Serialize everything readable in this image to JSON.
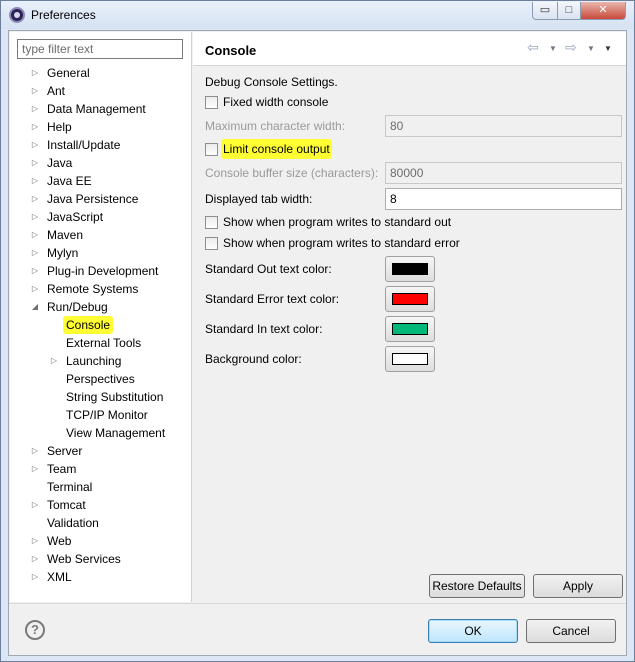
{
  "window": {
    "title": "Preferences",
    "minimize_glyph": "▭",
    "maximize_glyph": "□",
    "close_glyph": "✕"
  },
  "filter": {
    "placeholder": "type filter text"
  },
  "tree": [
    {
      "label": "General",
      "twisty": "▷",
      "level": 0
    },
    {
      "label": "Ant",
      "twisty": "▷",
      "level": 0
    },
    {
      "label": "Data Management",
      "twisty": "▷",
      "level": 0
    },
    {
      "label": "Help",
      "twisty": "▷",
      "level": 0
    },
    {
      "label": "Install/Update",
      "twisty": "▷",
      "level": 0
    },
    {
      "label": "Java",
      "twisty": "▷",
      "level": 0
    },
    {
      "label": "Java EE",
      "twisty": "▷",
      "level": 0
    },
    {
      "label": "Java Persistence",
      "twisty": "▷",
      "level": 0
    },
    {
      "label": "JavaScript",
      "twisty": "▷",
      "level": 0
    },
    {
      "label": "Maven",
      "twisty": "▷",
      "level": 0
    },
    {
      "label": "Mylyn",
      "twisty": "▷",
      "level": 0
    },
    {
      "label": "Plug-in Development",
      "twisty": "▷",
      "level": 0
    },
    {
      "label": "Remote Systems",
      "twisty": "▷",
      "level": 0
    },
    {
      "label": "Run/Debug",
      "twisty": "◢",
      "level": 0
    },
    {
      "label": "Console",
      "twisty": "",
      "level": 1,
      "selected": true
    },
    {
      "label": "External Tools",
      "twisty": "",
      "level": 1
    },
    {
      "label": "Launching",
      "twisty": "▷",
      "level": 1
    },
    {
      "label": "Perspectives",
      "twisty": "",
      "level": 1
    },
    {
      "label": "String Substitution",
      "twisty": "",
      "level": 1
    },
    {
      "label": "TCP/IP Monitor",
      "twisty": "",
      "level": 1
    },
    {
      "label": "View Management",
      "twisty": "",
      "level": 1
    },
    {
      "label": "Server",
      "twisty": "▷",
      "level": 0
    },
    {
      "label": "Team",
      "twisty": "▷",
      "level": 0
    },
    {
      "label": "Terminal",
      "twisty": "",
      "level": 0
    },
    {
      "label": "Tomcat",
      "twisty": "▷",
      "level": 0
    },
    {
      "label": "Validation",
      "twisty": "",
      "level": 0
    },
    {
      "label": "Web",
      "twisty": "▷",
      "level": 0
    },
    {
      "label": "Web Services",
      "twisty": "▷",
      "level": 0
    },
    {
      "label": "XML",
      "twisty": "▷",
      "level": 0
    }
  ],
  "page": {
    "title": "Console",
    "nav": {
      "back": "⇦",
      "forward": "⇨",
      "dropdown": "▼",
      "menu": "▼"
    },
    "intro": "Debug Console Settings.",
    "fixed_width_label": "Fixed width console",
    "max_char_width_label": "Maximum character width:",
    "max_char_width_value": "80",
    "limit_output_label": "Limit console output",
    "buffer_size_label": "Console buffer size (characters):",
    "buffer_size_value": "80000",
    "tab_width_label": "Displayed tab width:",
    "tab_width_value": "8",
    "show_stdout_label": "Show when program writes to standard out",
    "show_stderr_label": "Show when program writes to standard error",
    "stdout_color_label": "Standard Out text color:",
    "stderr_color_label": "Standard Error text color:",
    "stdin_color_label": "Standard In text color:",
    "background_color_label": "Background color:",
    "colors": {
      "stdout": "#000000",
      "stderr": "#ff0000",
      "stdin": "#00b878",
      "background": "#ffffff"
    },
    "restore_defaults_label": "Restore Defaults",
    "apply_label": "Apply"
  },
  "footer": {
    "help_glyph": "?",
    "ok_label": "OK",
    "cancel_label": "Cancel"
  }
}
